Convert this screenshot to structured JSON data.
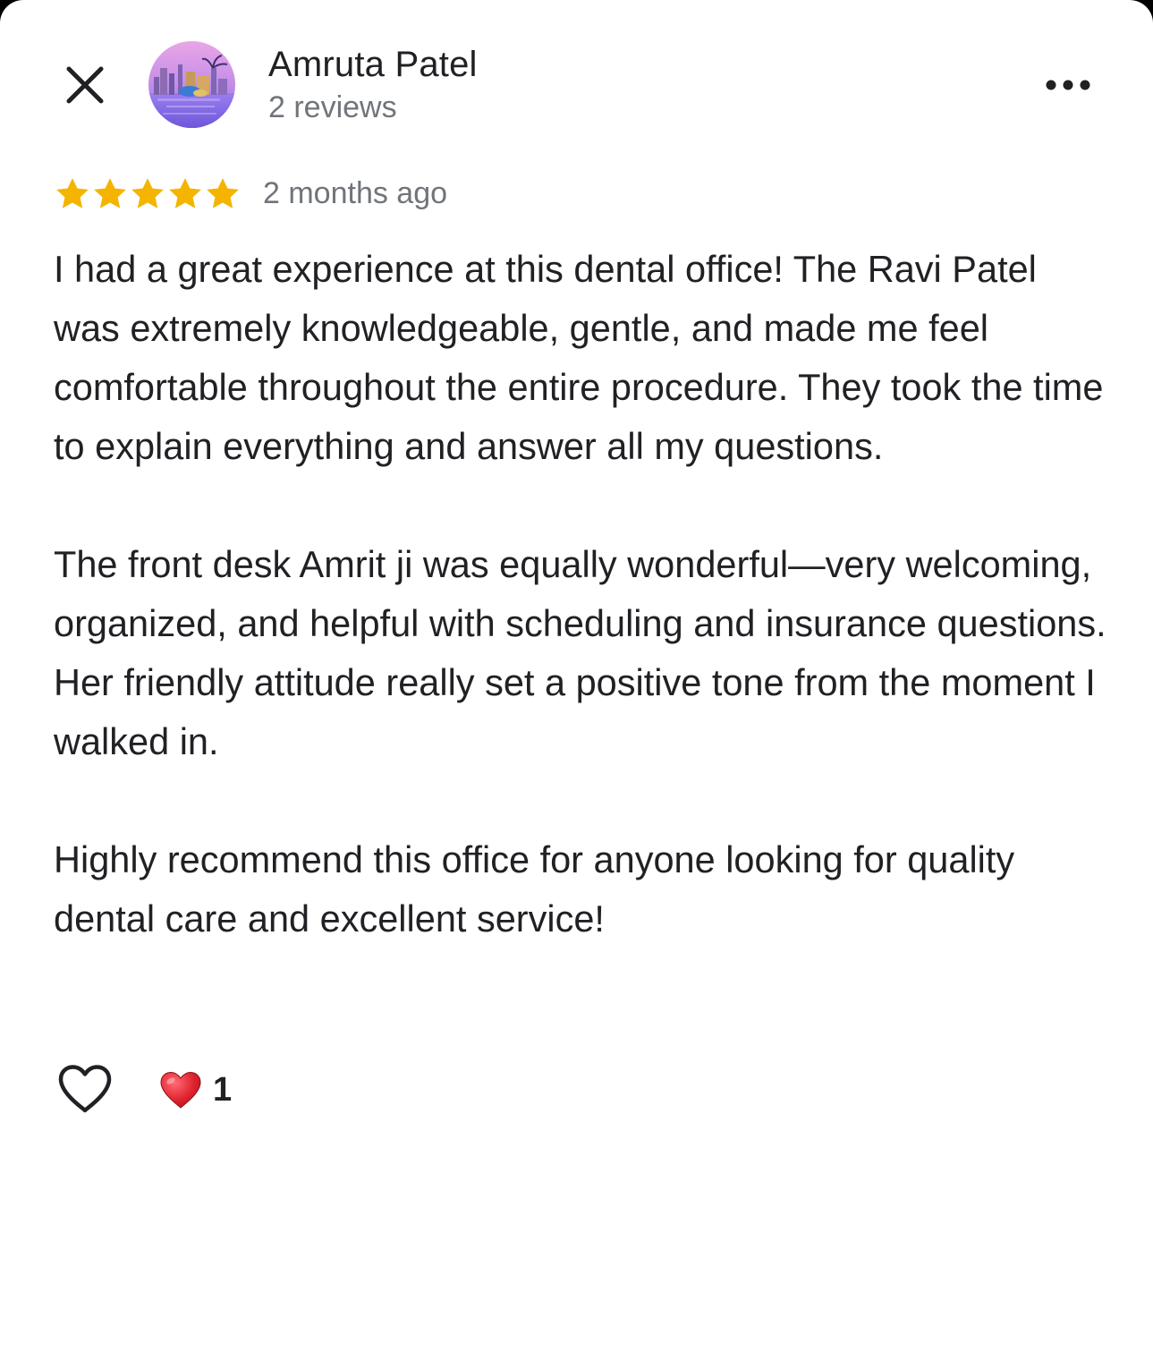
{
  "header": {
    "close_icon": "close-icon",
    "user_name": "Amruta Patel",
    "review_count": "2 reviews",
    "more_icon": "more-horizontal-icon"
  },
  "review": {
    "rating": 5,
    "max_rating": 5,
    "star_color": "#f4b400",
    "time_ago": "2 months ago",
    "paragraphs": [
      "I had a great experience at this dental office! The Ravi Patel was extremely knowledgeable, gentle, and made me feel comfortable throughout the entire procedure. They took the time to explain everything and answer all my questions.",
      "The front desk Amrit ji was equally wonderful—very welcoming, organized, and helpful with scheduling and insurance questions. Her friendly attitude really set a positive tone from the moment I walked in.",
      "Highly recommend this office for anyone looking for quality dental care and excellent service!"
    ]
  },
  "reactions": {
    "like_icon": "heart-outline-icon",
    "reaction_icon": "red-heart-icon",
    "reaction_color": "#e0242f",
    "count": "1"
  },
  "colors": {
    "text_primary": "#202124",
    "text_secondary": "#70757a",
    "background": "#ffffff"
  }
}
